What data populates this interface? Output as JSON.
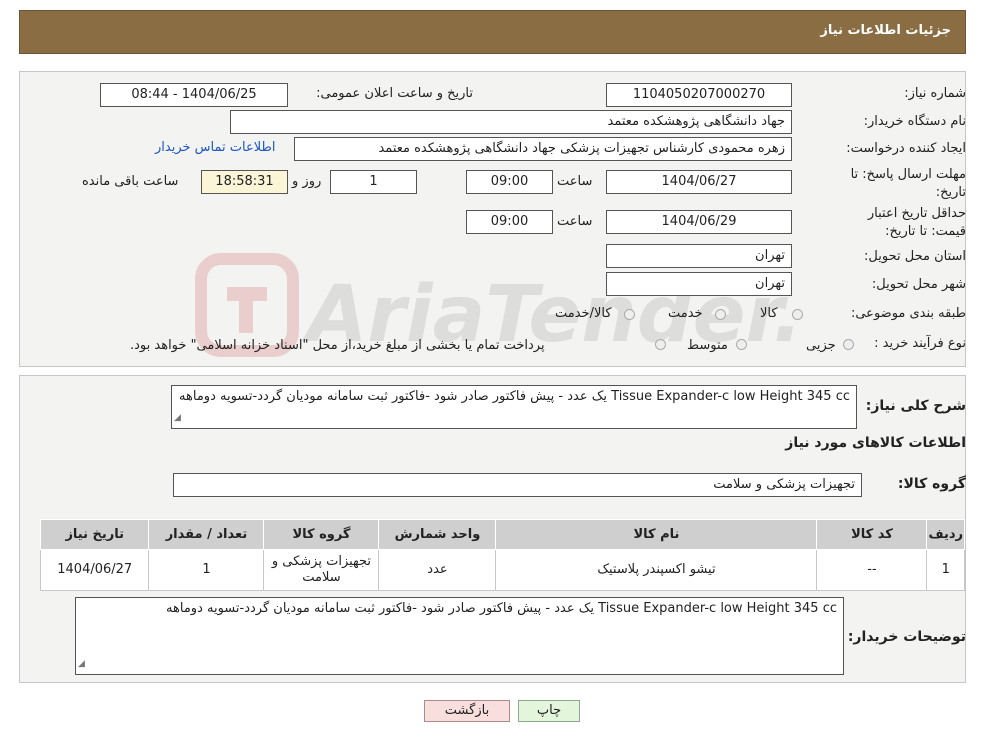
{
  "header": {
    "title": "جزئیات اطلاعات نیاز"
  },
  "form": {
    "need_number_label": "شماره نیاز:",
    "need_number": "1104050207000270",
    "announce_label": "تاریخ و ساعت اعلان عمومی:",
    "announce_value": "1404/06/25 - 08:44",
    "buyer_org_label": "نام دستگاه خریدار:",
    "buyer_org": "جهاد دانشگاهی پژوهشکده معتمد",
    "requester_label": "ایجاد کننده درخواست:",
    "requester": "زهره محمودی کارشناس تجهیزات پزشکی جهاد دانشگاهی پژوهشکده معتمد",
    "contact_link": "اطلاعات تماس خریدار",
    "deadline_label": "مهلت ارسال پاسخ: تا تاریخ:",
    "deadline_date": "1404/06/27",
    "time_label": "ساعت",
    "deadline_time": "09:00",
    "days_value": "1",
    "days_label": "روز و",
    "remaining_time": "18:58:31",
    "remaining_label": "ساعت باقی مانده",
    "validity_label": "حداقل تاریخ اعتبار قیمت: تا تاریخ:",
    "validity_date": "1404/06/29",
    "validity_time": "09:00",
    "province_label": "استان محل تحویل:",
    "province": "تهران",
    "city_label": "شهر محل تحویل:",
    "city": "تهران",
    "category_label": "طبقه بندی موضوعی:",
    "category_options": [
      "کالا",
      "خدمت",
      "کالا/خدمت"
    ],
    "process_label": "نوع فرآیند خرید :",
    "process_options": [
      "جزیی",
      "متوسط"
    ],
    "process_note": "پرداخت تمام یا بخشی از مبلغ خرید،از محل \"اسناد خزانه اسلامی\" خواهد بود."
  },
  "details": {
    "summary_label": "شرح کلی نیاز:",
    "summary_text": "Tissue Expander-c low Height 345 cc یک عدد - پیش فاکتور صادر شود -فاکتور ثبت سامانه مودیان گردد-تسویه دوماهه",
    "goods_info_title": "اطلاعات کالاهای مورد نیاز",
    "goods_group_label": "گروه کالا:",
    "goods_group": "تجهیزات پزشکی و سلامت",
    "table": {
      "headers": [
        "ردیف",
        "کد کالا",
        "نام کالا",
        "واحد شمارش",
        "گروه کالا",
        "تعداد / مقدار",
        "تاریخ نیاز"
      ],
      "rows": [
        [
          "1",
          "--",
          "تیشو اکسپندر پلاستیک",
          "عدد",
          "تجهیزات پزشکی و سلامت",
          "1",
          "1404/06/27"
        ]
      ]
    },
    "buyer_notes_label": "توضیحات خریدار:",
    "buyer_notes": "Tissue Expander-c low Height 345 cc یک عدد - پیش فاکتور صادر شود -فاکتور ثبت سامانه مودیان گردد-تسویه دوماهه"
  },
  "buttons": {
    "print": "چاپ",
    "back": "بازگشت"
  },
  "watermark": {
    "text": "AriaTender.neT"
  },
  "colors": {
    "header_bg": "#8b6d44",
    "panel_bg": "#f3f3f1",
    "link": "#1a56c4",
    "back_btn": "#f9dede",
    "print_btn": "#e3f5da"
  }
}
